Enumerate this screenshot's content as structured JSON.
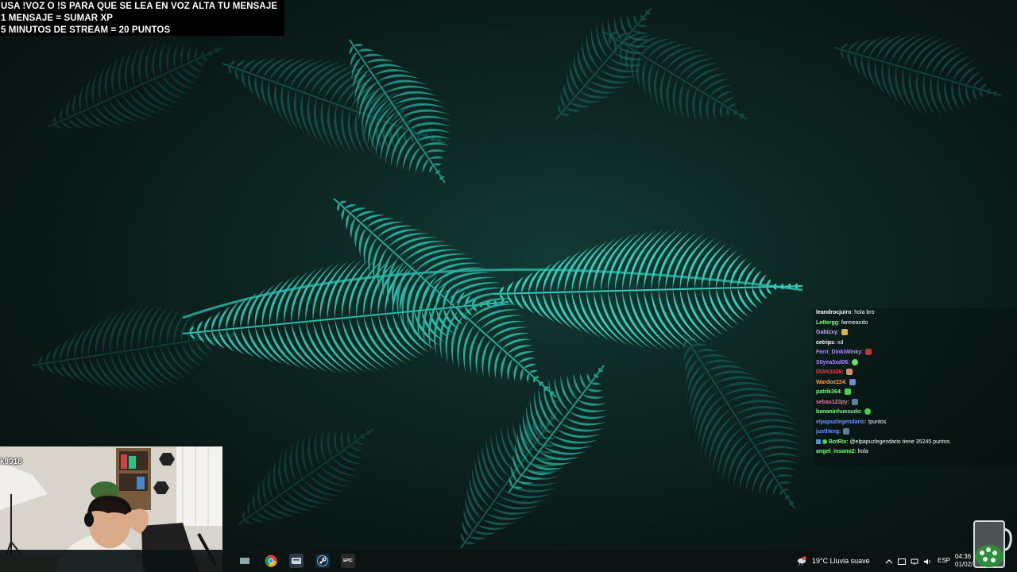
{
  "banner": {
    "line1": "USA !VOZ O !S PARA QUE SE LEA EN VOZ ALTA TU MENSAJE",
    "line2": "1 MENSAJE = SUMAR XP",
    "line3": "5 MINUTOS DE STREAM = 20 PUNTOS"
  },
  "chat": {
    "messages": [
      {
        "user": "leandrocjuiro",
        "text": ": hola bro",
        "color": "#ffffff",
        "emote": ""
      },
      {
        "user": "Lettergg",
        "text": ": farmeando",
        "color": "#7cfc7c",
        "emote": ""
      },
      {
        "user": "Gabizxy",
        "text": ":",
        "color": "#c9a0ff",
        "emote": "#d9b44a"
      },
      {
        "user": "cetrips",
        "text": ": xd",
        "color": "#ffffff",
        "emote": ""
      },
      {
        "user": "Ferri_DinkiWinky",
        "text": ":",
        "color": "#b58cff",
        "emote": "#c0392b"
      },
      {
        "user": "S0yea3xd06",
        "text": ":",
        "color": "#b58cff",
        "emote": "#6fd86f"
      },
      {
        "user": "DIAN1026",
        "text": ":",
        "color": "#ff3b3b",
        "emote": "#d98c6a"
      },
      {
        "user": "Wardoz224",
        "text": ":",
        "color": "#ff9f40",
        "emote": "#6a8cc8"
      },
      {
        "user": "patrik364",
        "text": ":",
        "color": "#7cfc7c",
        "emote": "#46d146"
      },
      {
        "user": "sebas123py",
        "text": ":",
        "color": "#ff6fa8",
        "emote": "#5f7f9f"
      },
      {
        "user": "bananinhuesudo",
        "text": ":",
        "color": "#7cfc7c",
        "emote": "#46d146"
      },
      {
        "user": "elpapuzlegendario",
        "text": ": !puntos",
        "color": "#6f8fff",
        "emote": ""
      },
      {
        "user": "justhkng",
        "text": ":",
        "color": "#6f8fff",
        "emote": "#5f7f9f"
      },
      {
        "user": "BotRix",
        "text": ": @elpapuzlegendario tiene 35245 puntos.",
        "color": "#7cfc7c",
        "emote": ""
      },
      {
        "user": "angel_insano2",
        "text": ": hola",
        "color": "#7cfc7c",
        "emote": ""
      }
    ]
  },
  "webcam": {
    "username_overlay": "k8918"
  },
  "taskbar": {
    "apps": [
      {
        "name": "app-icon-1",
        "label": ""
      },
      {
        "name": "chrome-icon",
        "label": ""
      },
      {
        "name": "app-icon-3",
        "label": ""
      },
      {
        "name": "steam-icon",
        "label": ""
      },
      {
        "name": "epic-games-icon",
        "label": "EPIC"
      }
    ],
    "weather_temp": "19°C",
    "weather_desc": "Lluvia suave",
    "weather_alert": "1",
    "language": "ESP",
    "time": "04:36",
    "date": "01/02/"
  },
  "colors": {
    "banner_bg": "#000000",
    "taskbar_bg": "#0c1414",
    "fern": "#2fc3b2"
  }
}
